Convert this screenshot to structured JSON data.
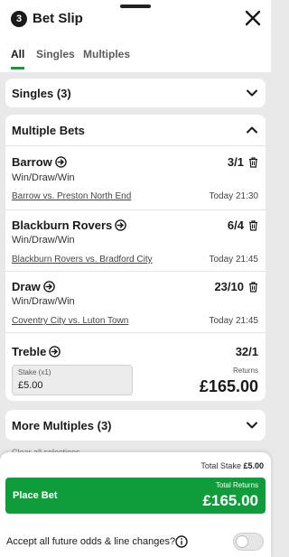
{
  "header": {
    "count": "3",
    "title": "Bet Slip",
    "close_icon": "close-icon"
  },
  "tabs": [
    {
      "label": "All",
      "active": true
    },
    {
      "label": "Singles",
      "active": false
    },
    {
      "label": "Multiples",
      "active": false
    }
  ],
  "singles": {
    "title": "Singles (3)",
    "expanded": false
  },
  "multiple_bets": {
    "title": "Multiple Bets",
    "expanded": true,
    "selections": [
      {
        "name": "Barrow",
        "odds": "3/1",
        "market": "Win/Draw/Win",
        "event": "Barrow vs. Preston North End",
        "time": "Today 21:30"
      },
      {
        "name": "Blackburn Rovers",
        "odds": "6/4",
        "market": "Win/Draw/Win",
        "event": "Blackburn Rovers vs. Bradford City",
        "time": "Today 21:45"
      },
      {
        "name": "Draw",
        "odds": "23/10",
        "market": "Win/Draw/Win",
        "event": "Coventry City vs. Luton Town",
        "time": "Today 21:45"
      }
    ],
    "treble": {
      "name": "Treble",
      "odds": "32/1",
      "stake_label": "Stake (x1)",
      "stake_value": "£5.00",
      "returns_label": "Returns",
      "returns_value": "£165.00"
    }
  },
  "more_multiples": {
    "title": "More Multiples (3)",
    "expanded": false
  },
  "clear_all": "Clear all selections",
  "footer": {
    "total_stake_label": "Total Stake",
    "total_stake_value": "£5.00",
    "place_bet_label": "Place Bet",
    "total_returns_label": "Total Returns",
    "total_returns_value": "£165.00",
    "accept_label": "Accept all future odds & line changes?",
    "accept_toggle_on": false
  },
  "colors": {
    "accent_green": "#0f9d3c",
    "background": "#e9e9e9",
    "card": "#ffffff"
  }
}
